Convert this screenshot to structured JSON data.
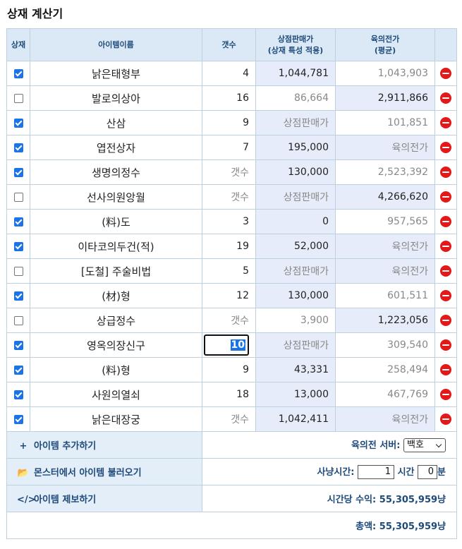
{
  "title": "상재 계산기",
  "headers": {
    "check": "상재",
    "name": "아이템이름",
    "count": "갯수",
    "sell_line1": "상점판매가",
    "sell_line2": "(상재 특성 적용)",
    "avg_line1": "육의전가",
    "avg_line2": "(평균)"
  },
  "placeholders": {
    "count": "갯수",
    "sell": "상점판매가",
    "avg": "육의전가"
  },
  "rows": [
    {
      "checked": true,
      "name": "낡은태형부",
      "count": "4",
      "sell": "1,044,781",
      "avg": "1,043,903",
      "avg_dim": true
    },
    {
      "checked": false,
      "name": "발로의상아",
      "count": "16",
      "sell": "86,664",
      "avg": "2,911,866",
      "sell_dim": true
    },
    {
      "checked": true,
      "name": "산삼",
      "count": "9",
      "sell": "",
      "avg": "101,851",
      "avg_dim": true
    },
    {
      "checked": true,
      "name": "엽전상자",
      "count": "7",
      "sell": "195,000",
      "avg": ""
    },
    {
      "checked": true,
      "name": "생명의정수",
      "count": "",
      "sell": "130,000",
      "avg": "2,523,392",
      "avg_dim": true
    },
    {
      "checked": false,
      "name": "선사의원앙월",
      "count": "",
      "sell": "",
      "avg": "4,266,620"
    },
    {
      "checked": true,
      "name": "(料)도",
      "count": "3",
      "sell": "0",
      "avg": "957,565",
      "avg_dim": true
    },
    {
      "checked": true,
      "name": "이타코의두건(적)",
      "count": "19",
      "sell": "52,000",
      "avg": ""
    },
    {
      "checked": false,
      "name": "[도철] 주술비법",
      "count": "5",
      "sell": "",
      "avg": ""
    },
    {
      "checked": true,
      "name": "(材)형",
      "count": "12",
      "sell": "130,000",
      "avg": "601,511",
      "avg_dim": true
    },
    {
      "checked": false,
      "name": "상급정수",
      "count": "",
      "sell": "3,900",
      "avg": "1,223,056",
      "sell_dim": true
    },
    {
      "checked": true,
      "name": "영옥의장신구",
      "count": "10",
      "sell": "",
      "avg": "309,540",
      "avg_dim": true,
      "editing": true
    },
    {
      "checked": true,
      "name": "(料)형",
      "count": "9",
      "sell": "43,331",
      "avg": "258,494",
      "avg_dim": true
    },
    {
      "checked": true,
      "name": "사원의열쇠",
      "count": "18",
      "sell": "13,000",
      "avg": "467,769",
      "avg_dim": true
    },
    {
      "checked": true,
      "name": "낡은대장궁",
      "count": "",
      "sell": "1,042,411",
      "avg": ""
    }
  ],
  "actions": {
    "add_item": "아이템 추가하기",
    "load_monster": "몬스터에서 아이템 불러오기",
    "report_item": "아이템 제보하기"
  },
  "server": {
    "label": "육의전 서버:",
    "value": "백호"
  },
  "hunting": {
    "label": "사냥시간:",
    "hours": "1",
    "hours_unit": "시간",
    "minutes": "0",
    "minutes_unit": "분"
  },
  "hourly": {
    "label": "시간당 수익:",
    "value": "55,305,959냥"
  },
  "total": {
    "label": "총액:",
    "value": "55,305,959냥"
  },
  "colors": {
    "header_bg": "#dbe9f6",
    "accent": "#1e4a7a",
    "highlight": "#e6ecfa",
    "delete": "#e31818",
    "checkbox": "#1a73e8"
  },
  "icons": {
    "add": "plus-icon",
    "load": "folder-open-icon",
    "report": "code-icon",
    "delete": "remove-circle-icon"
  }
}
